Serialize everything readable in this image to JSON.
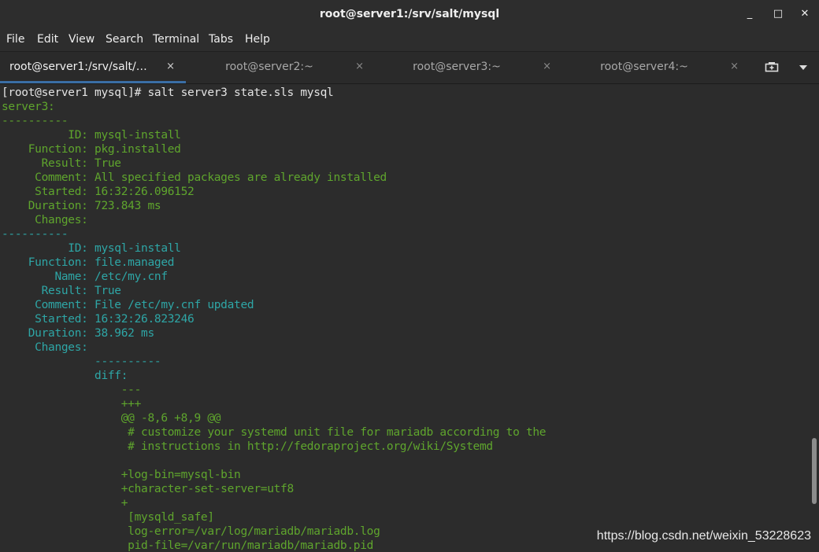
{
  "window": {
    "title": "root@server1:/srv/salt/mysql",
    "minimize": "_",
    "maximize": "□",
    "close": "✕"
  },
  "menu": [
    "File",
    "Edit",
    "View",
    "Search",
    "Terminal",
    "Tabs",
    "Help"
  ],
  "tabs": [
    {
      "label": "root@server1:/srv/salt/…",
      "active": true
    },
    {
      "label": "root@server2:~",
      "active": false
    },
    {
      "label": "root@server3:~",
      "active": false
    },
    {
      "label": "root@server4:~",
      "active": false
    }
  ],
  "tab_close_glyph": "×",
  "tab_actions": {
    "new_tab_icon": "new-tab-icon",
    "menu_icon": "chevron-down-icon"
  },
  "terminal": {
    "lines": [
      {
        "text": "[root@server1 mysql]# salt server3 state.sls mysql",
        "color": "white"
      },
      {
        "text": "server3:",
        "color": "green"
      },
      {
        "text": "----------",
        "color": "green"
      },
      {
        "text": "          ID: mysql-install",
        "color": "green"
      },
      {
        "text": "    Function: pkg.installed",
        "color": "green"
      },
      {
        "text": "      Result: True",
        "color": "green"
      },
      {
        "text": "     Comment: All specified packages are already installed",
        "color": "green"
      },
      {
        "text": "     Started: 16:32:26.096152",
        "color": "green"
      },
      {
        "text": "    Duration: 723.843 ms",
        "color": "green"
      },
      {
        "text": "     Changes:",
        "color": "green"
      },
      {
        "text": "----------",
        "color": "cyan"
      },
      {
        "text": "          ID: mysql-install",
        "color": "cyan"
      },
      {
        "text": "    Function: file.managed",
        "color": "cyan"
      },
      {
        "text": "        Name: /etc/my.cnf",
        "color": "cyan"
      },
      {
        "text": "      Result: True",
        "color": "cyan"
      },
      {
        "text": "     Comment: File /etc/my.cnf updated",
        "color": "cyan"
      },
      {
        "text": "     Started: 16:32:26.823246",
        "color": "cyan"
      },
      {
        "text": "    Duration: 38.962 ms",
        "color": "cyan"
      },
      {
        "text": "     Changes:",
        "color": "cyan"
      },
      {
        "text": "              ----------",
        "color": "cyan"
      },
      {
        "text": "              diff:",
        "color": "cyan"
      },
      {
        "text": "                  ---",
        "color": "green"
      },
      {
        "text": "                  +++",
        "color": "green"
      },
      {
        "text": "                  @@ -8,6 +8,9 @@",
        "color": "green"
      },
      {
        "text": "                   # customize your systemd unit file for mariadb according to the",
        "color": "green"
      },
      {
        "text": "                   # instructions in http://fedoraproject.org/wiki/Systemd",
        "color": "green"
      },
      {
        "text": "",
        "color": "green"
      },
      {
        "text": "                  +log-bin=mysql-bin",
        "color": "green"
      },
      {
        "text": "                  +character-set-server=utf8",
        "color": "green"
      },
      {
        "text": "                  +",
        "color": "green"
      },
      {
        "text": "                   [mysqld_safe]",
        "color": "green"
      },
      {
        "text": "                   log-error=/var/log/mariadb/mariadb.log",
        "color": "green"
      },
      {
        "text": "                   pid-file=/var/run/mariadb/mariadb.pid",
        "color": "green"
      }
    ]
  },
  "colors": {
    "white": "#e3e3e3",
    "green": "#5fa52d",
    "cyan": "#2ea6a6",
    "accent": "#3a6ea5"
  },
  "watermark": "https://blog.csdn.net/weixin_53228623"
}
